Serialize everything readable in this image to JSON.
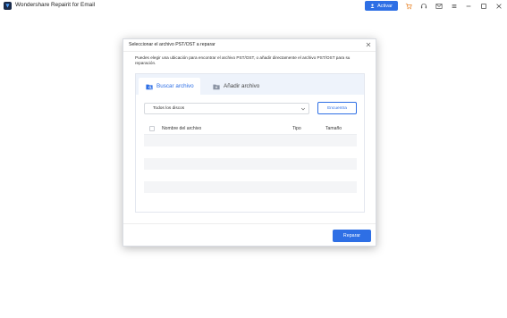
{
  "app": {
    "title": "Wondershare Repairit for Email",
    "activate_label": "Activar"
  },
  "dialog": {
    "title": "Seleccionar el archivo PST/OST a reparar",
    "description": "Puedes elegir una ubicación para encontrar el archivo PST/OST, o añadir directamente el archivo PST/OST para su reparación.",
    "tabs": [
      {
        "label": "Buscar archivo",
        "active": true
      },
      {
        "label": "Añadir archivo",
        "active": false
      }
    ],
    "location_select": {
      "value": "Todos los discos"
    },
    "find_button_label": "Encuentra",
    "table": {
      "columns": [
        "Nombre del archivo",
        "Tipo",
        "Tamaño"
      ],
      "rows": []
    },
    "repair_button_label": "Reparar"
  },
  "colors": {
    "accent": "#2e6fe5",
    "tab_bar": "#eef3fb",
    "cart": "#e8842a"
  }
}
